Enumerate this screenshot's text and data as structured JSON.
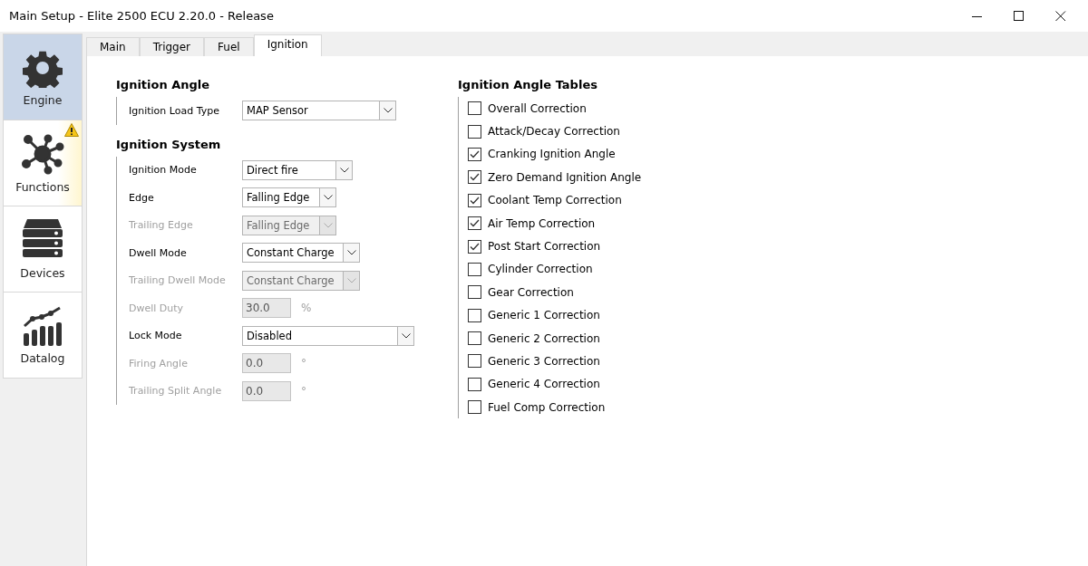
{
  "window": {
    "title": "Main Setup - Elite 2500 ECU 2.20.0 - Release"
  },
  "sidebar": {
    "items": [
      {
        "kind": "engine",
        "label": "Engine",
        "selected": true,
        "warning": false
      },
      {
        "kind": "functions",
        "label": "Functions",
        "selected": false,
        "warning": true
      },
      {
        "kind": "devices",
        "label": "Devices",
        "selected": false,
        "warning": false
      },
      {
        "kind": "datalog",
        "label": "Datalog",
        "selected": false,
        "warning": false
      }
    ]
  },
  "tabs": [
    {
      "label": "Main",
      "selected": false
    },
    {
      "label": "Trigger",
      "selected": false
    },
    {
      "label": "Fuel",
      "selected": false
    },
    {
      "label": "Ignition",
      "selected": true
    }
  ],
  "sections": [
    {
      "title": "Ignition Angle",
      "rows": [
        {
          "kind": "select",
          "label": "Ignition Load Type",
          "value": "MAP Sensor",
          "disabled": false
        }
      ]
    },
    {
      "title": "Ignition System",
      "rows": [
        {
          "kind": "select",
          "label": "Ignition Mode",
          "value": "Direct fire",
          "disabled": false
        },
        {
          "kind": "select",
          "label": "Edge",
          "value": "Falling Edge",
          "disabled": false
        },
        {
          "kind": "select",
          "label": "Trailing Edge",
          "value": "Falling Edge",
          "disabled": true
        },
        {
          "kind": "select",
          "label": "Dwell Mode",
          "value": "Constant Charge",
          "disabled": false
        },
        {
          "kind": "select",
          "label": "Trailing Dwell Mode",
          "value": "Constant Charge",
          "disabled": true
        },
        {
          "kind": "number",
          "label": "Dwell Duty",
          "value": "30.0",
          "unit": "%",
          "disabled": true
        },
        {
          "kind": "select",
          "label": "Lock Mode",
          "value": "Disabled",
          "disabled": false
        },
        {
          "kind": "number",
          "label": "Firing Angle",
          "value": "0.0",
          "unit": "°",
          "disabled": true
        },
        {
          "kind": "number",
          "label": "Trailing Split Angle",
          "value": "0.0",
          "unit": "°",
          "disabled": true
        }
      ]
    }
  ],
  "tables": {
    "title": "Ignition Angle Tables",
    "items": [
      {
        "label": "Overall Correction",
        "checked": false
      },
      {
        "label": "Attack/Decay Correction",
        "checked": false
      },
      {
        "label": "Cranking Ignition Angle",
        "checked": true
      },
      {
        "label": "Zero Demand Ignition Angle",
        "checked": true
      },
      {
        "label": "Coolant Temp Correction",
        "checked": true
      },
      {
        "label": "Air Temp Correction",
        "checked": true
      },
      {
        "label": "Post Start Correction",
        "checked": true
      },
      {
        "label": "Cylinder Correction",
        "checked": false
      },
      {
        "label": "Gear Correction",
        "checked": false
      },
      {
        "label": "Generic 1 Correction",
        "checked": false
      },
      {
        "label": "Generic 2 Correction",
        "checked": false
      },
      {
        "label": "Generic 3 Correction",
        "checked": false
      },
      {
        "label": "Generic 4 Correction",
        "checked": false
      },
      {
        "label": "Fuel Comp Correction",
        "checked": false
      }
    ]
  }
}
